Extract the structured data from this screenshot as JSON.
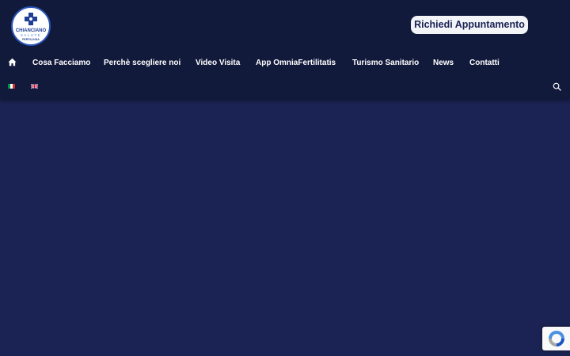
{
  "header": {
    "logo": {
      "line1": "CHIANCIANO",
      "line2": "SALUTE",
      "line3": "FERTILOGIA",
      "icon": "medical-cross-icon"
    },
    "cta_label": "Richiedi Appuntamento"
  },
  "nav": {
    "home_icon": "home-icon",
    "items": [
      {
        "label": "Cosa Facciamo"
      },
      {
        "label": "Perchè scegliere noi"
      },
      {
        "label": "Video Visita"
      },
      {
        "label": "App OmniaFertilitatis"
      },
      {
        "label": "Turismo Sanitario"
      },
      {
        "label": "News"
      },
      {
        "label": "Contatti"
      }
    ]
  },
  "languages": {
    "flags": [
      "italian-flag-icon",
      "english-flag-icon"
    ],
    "search_icon": "search-icon"
  },
  "recaptcha": {
    "icon": "recaptcha-icon"
  },
  "colors": {
    "header_bg": "#121a3c",
    "page_bg": "#1b2354",
    "cta_bg": "#f3f4f8",
    "nav_text": "#ffffff",
    "logo_ring": "#2a57b8"
  }
}
